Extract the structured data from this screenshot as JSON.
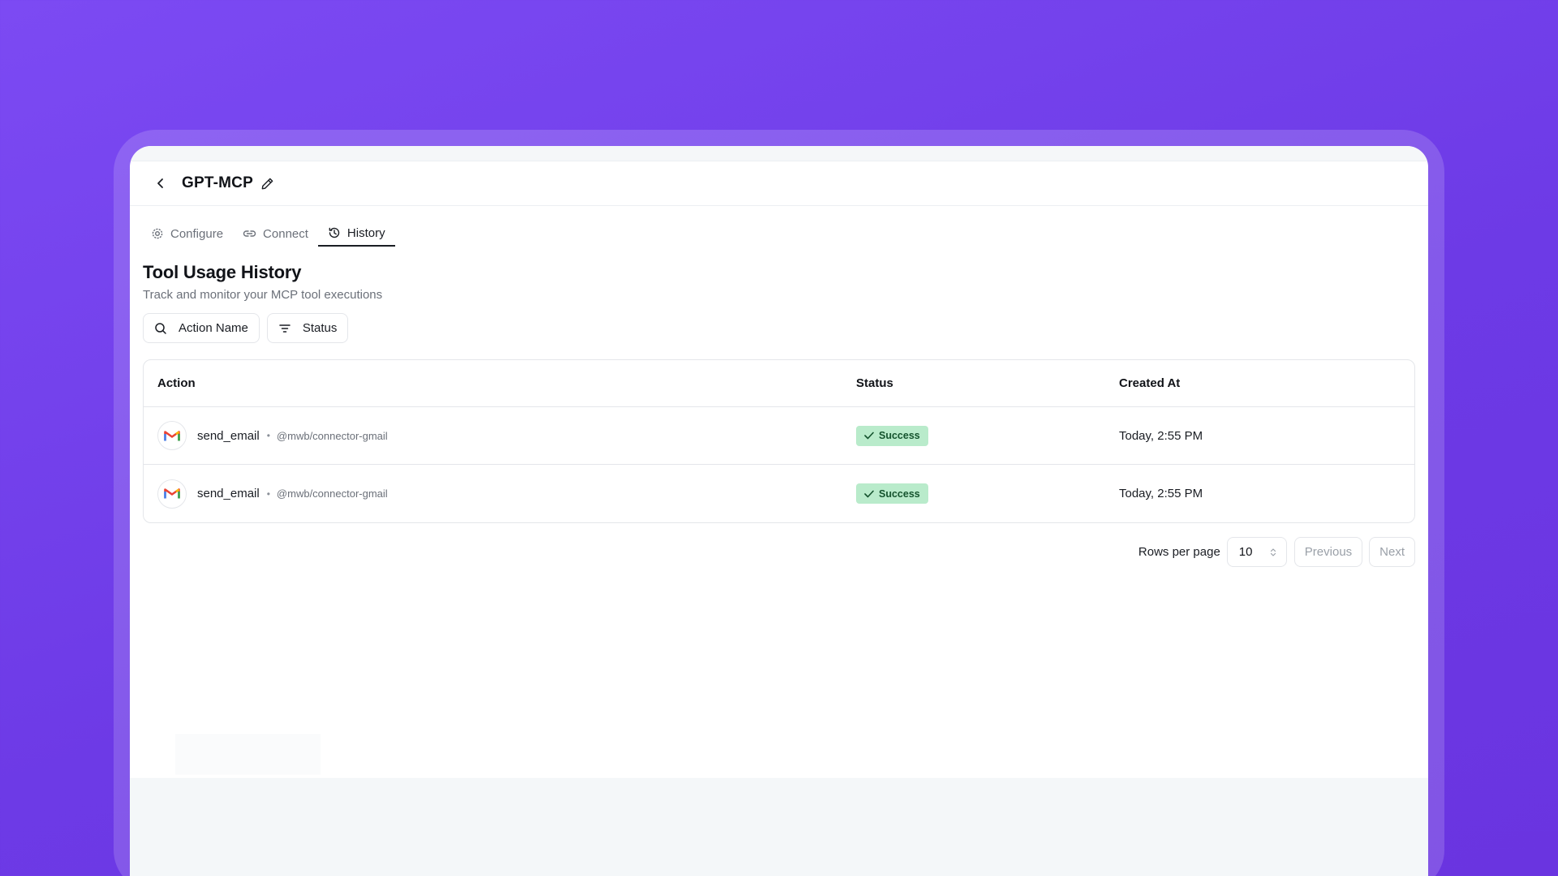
{
  "header": {
    "title": "GPT-MCP"
  },
  "tabs": [
    {
      "label": "Configure",
      "icon": "gear-icon"
    },
    {
      "label": "Connect",
      "icon": "link-icon"
    },
    {
      "label": "History",
      "icon": "history-icon",
      "active": true
    }
  ],
  "section": {
    "title": "Tool Usage History",
    "subtitle": "Track and monitor your MCP tool executions"
  },
  "filters": {
    "action_name": "Action Name",
    "status": "Status"
  },
  "table": {
    "columns": [
      "Action",
      "Status",
      "Created At"
    ],
    "rows": [
      {
        "action": "send_email",
        "connector": "@mwb/connector-gmail",
        "status": "Success",
        "created": "Today, 2:55 PM",
        "icon": "gmail-icon"
      },
      {
        "action": "send_email",
        "connector": "@mwb/connector-gmail",
        "status": "Success",
        "created": "Today, 2:55 PM",
        "icon": "gmail-icon"
      }
    ]
  },
  "pagination": {
    "rows_per_page_label": "Rows per page",
    "rows_per_page": "10",
    "previous": "Previous",
    "next": "Next"
  },
  "colors": {
    "background": "#7245EC",
    "success_badge": "#B9EBCB",
    "success_text": "#14532D"
  }
}
